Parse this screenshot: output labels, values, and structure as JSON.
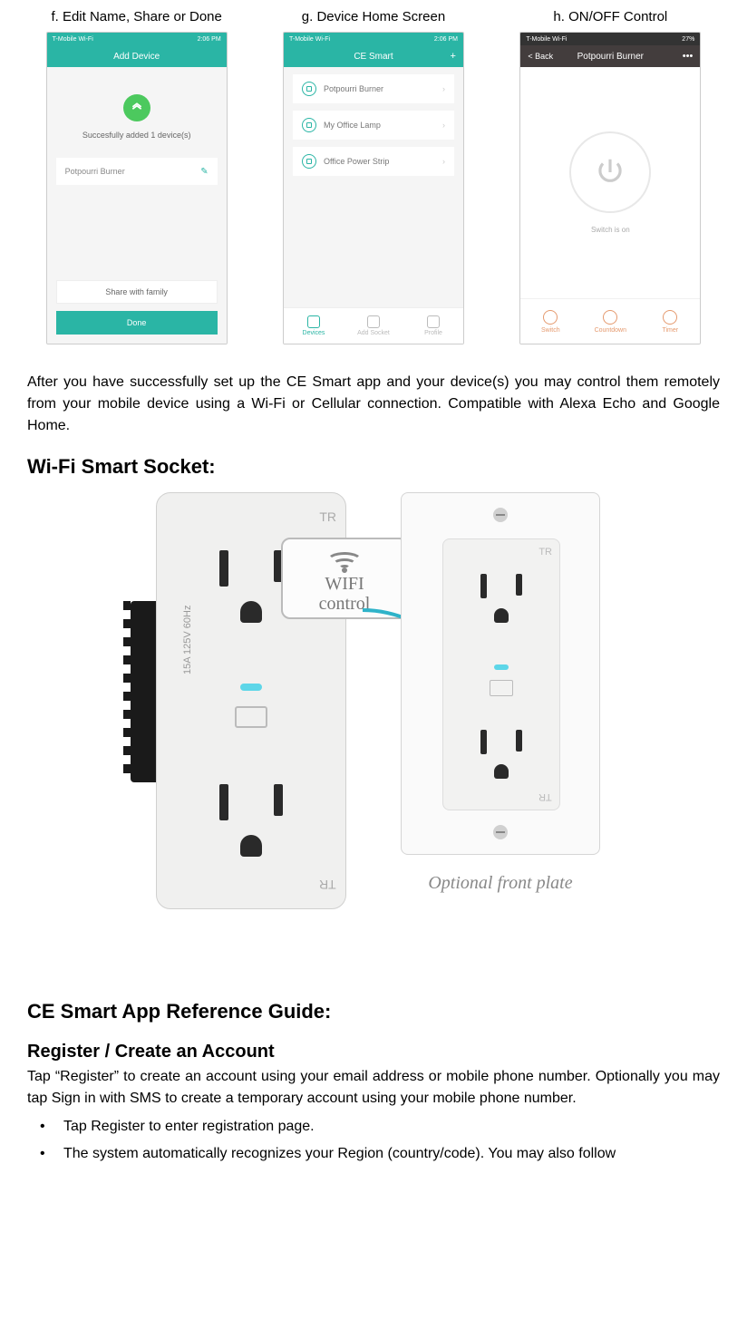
{
  "screenshots": {
    "f": {
      "caption": "f. Edit Name, Share or Done",
      "status_left": "T-Mobile Wi-Fi",
      "status_right": "2:06 PM",
      "nav_title": "Add Device",
      "success": "Succesfully added 1 device(s)",
      "device_name": "Potpourri Burner",
      "share": "Share with family",
      "done": "Done"
    },
    "g": {
      "caption": "g. Device Home Screen",
      "status_left": "T-Mobile Wi-Fi",
      "status_right": "2:06 PM",
      "nav_title": "CE Smart",
      "items": [
        "Potpourri Burner",
        "My Office Lamp",
        "Office Power Strip"
      ],
      "tabs": [
        "Devices",
        "Add Socket",
        "Profile"
      ]
    },
    "h": {
      "caption": "h. ON/OFF Control",
      "status_left": "T-Mobile Wi-Fi",
      "status_right": "27%",
      "nav_back": "< Back",
      "nav_title": "Potpourri Burner",
      "nav_more": "•••",
      "switch_text": "Switch is on",
      "tabs": [
        "Switch",
        "Countdown",
        "Timer"
      ]
    }
  },
  "para_after": "After you have successfully set up the CE Smart app and your device(s) you may control them remotely from your mobile device using a Wi-Fi or Cellular connection. Compatible with Alexa Echo and Google Home.",
  "socket_heading": "Wi-Fi Smart Socket:",
  "socket_figure": {
    "tr_label": "TR",
    "side_rating": "15A 125V 60Hz",
    "wifi_line1": "WIFI",
    "wifi_line2": "control",
    "optional": "Optional front plate"
  },
  "guide_heading": "CE Smart App Reference Guide:",
  "register": {
    "heading": "Register / Create an Account",
    "para": "Tap “Register” to create an account using your email address or mobile phone number. Optionally you may tap Sign in with SMS to create a temporary account using your mobile phone number.",
    "bullets": [
      "Tap Register to enter registration page.",
      "The system automatically recognizes your Region (country/code). You may also follow"
    ]
  }
}
